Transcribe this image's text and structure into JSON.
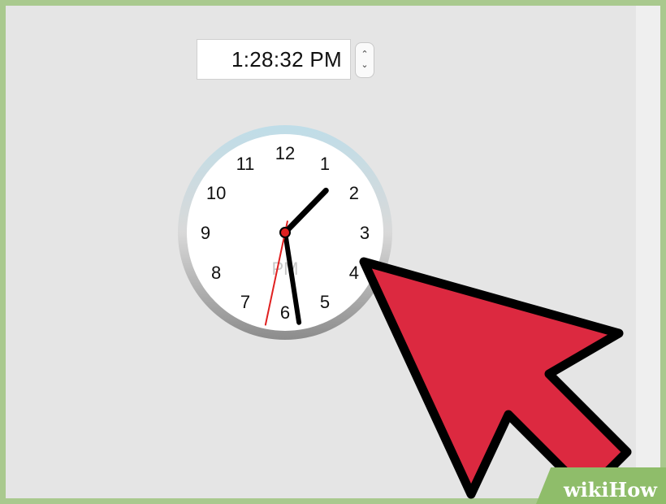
{
  "time_field": {
    "value": "1:28:32 PM"
  },
  "stepper": {
    "up_glyph": "⌃",
    "down_glyph": "⌄"
  },
  "clock": {
    "numerals": [
      "12",
      "1",
      "2",
      "3",
      "4",
      "5",
      "6",
      "7",
      "8",
      "9",
      "10",
      "11"
    ],
    "meridiem": "PM",
    "hour": 1,
    "minute": 28,
    "second": 32
  },
  "colors": {
    "frame_border": "#a9c98e",
    "pointer_fill": "#dc2940",
    "second_hand": "#e02020"
  },
  "icons": {
    "pointer": "arrow-cursor-icon"
  },
  "watermark": {
    "wiki": "wiki",
    "how": "How"
  }
}
